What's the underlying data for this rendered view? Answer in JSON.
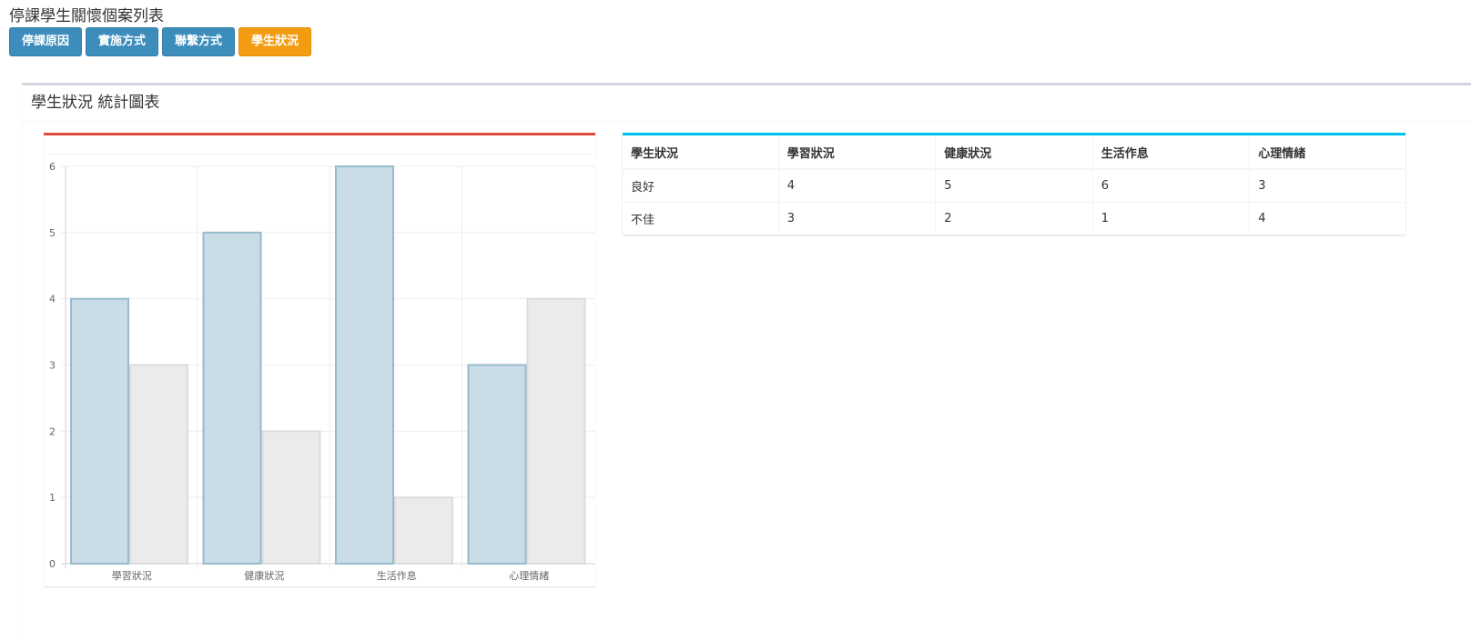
{
  "page": {
    "title": "停課學生關懷個案列表"
  },
  "tabs": [
    {
      "label": "停課原因",
      "active": false
    },
    {
      "label": "實施方式",
      "active": false
    },
    {
      "label": "聯繫方式",
      "active": false
    },
    {
      "label": "學生狀況",
      "active": true
    }
  ],
  "colors": {
    "tab_default": "#3c8dbc",
    "tab_active": "#f39c12",
    "chart_box_accent": "#dd4b39",
    "table_box_accent": "#00c0ef",
    "series_good_fill": "#cadde7",
    "series_good_stroke": "#97bbcd",
    "series_bad_fill": "#ebebeb",
    "series_bad_stroke": "#dcdcdc"
  },
  "panel": {
    "title": "學生狀況 統計圖表"
  },
  "chart_data": {
    "type": "bar",
    "categories": [
      "學習狀況",
      "健康狀況",
      "生活作息",
      "心理情緒"
    ],
    "series": [
      {
        "values": [
          4,
          5,
          6,
          3
        ]
      },
      {
        "values": [
          3,
          2,
          1,
          4
        ]
      }
    ],
    "yticks": [
      "0",
      "1",
      "2",
      "3",
      "4",
      "5",
      "6"
    ],
    "ylim": [
      0,
      6
    ],
    "grid": true
  },
  "table": {
    "headers": [
      "學生狀況",
      "學習狀況",
      "健康狀況",
      "生活作息",
      "心理情緒"
    ],
    "rows": [
      [
        "良好",
        "4",
        "5",
        "6",
        "3"
      ],
      [
        "不佳",
        "3",
        "2",
        "1",
        "4"
      ]
    ]
  }
}
